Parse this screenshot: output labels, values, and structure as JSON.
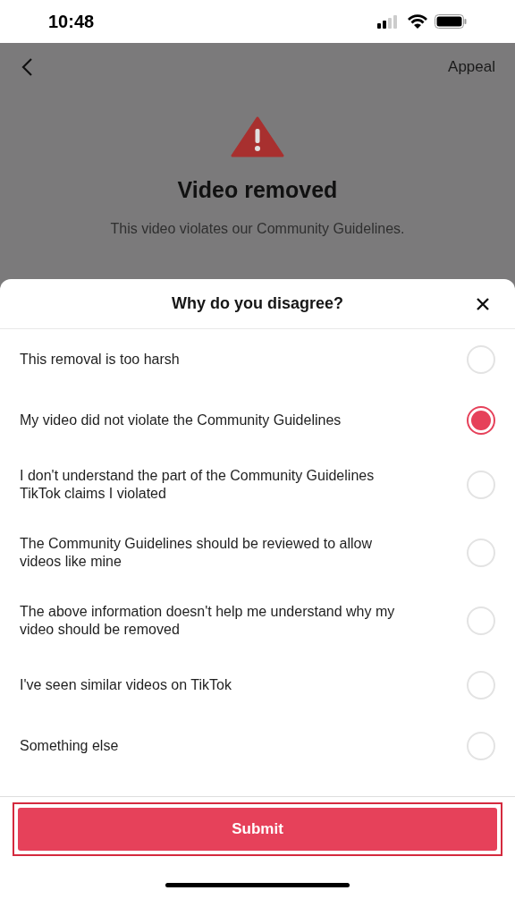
{
  "status_bar": {
    "time": "10:48"
  },
  "page": {
    "action": "Appeal",
    "title": "Video removed",
    "subtitle": "This video violates our Community Guidelines."
  },
  "sheet": {
    "title": "Why do you disagree?",
    "options": [
      {
        "label": "This removal is too harsh",
        "selected": false
      },
      {
        "label": "My video did not violate the Community Guidelines",
        "selected": true
      },
      {
        "label": "I don't understand the part of the Community Guidelines TikTok claims I violated",
        "selected": false
      },
      {
        "label": "The Community Guidelines should be reviewed to allow videos like mine",
        "selected": false
      },
      {
        "label": "The above information doesn't help me understand why my video should be removed",
        "selected": false
      },
      {
        "label": "I've seen similar videos on TikTok",
        "selected": false
      },
      {
        "label": "Something else",
        "selected": false
      }
    ],
    "submit": "Submit"
  }
}
